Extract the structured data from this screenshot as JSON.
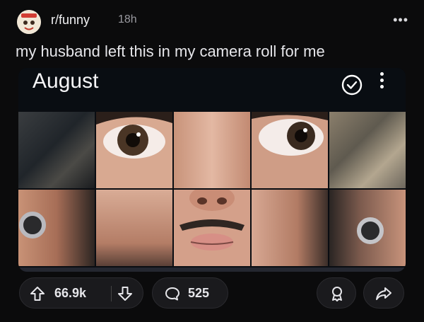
{
  "post": {
    "subreddit": "r/funny",
    "time": "18h",
    "more": "•••",
    "title": "my husband left this in my camera roll for me"
  },
  "media": {
    "album_title": "August"
  },
  "actions": {
    "upvotes": "66.9k",
    "comments": "525"
  },
  "icons": {
    "avatar": "subreddit-avatar",
    "more": "more-options-icon",
    "check": "select-check-icon",
    "kebab": "kebab-menu-icon",
    "upvote": "upvote-arrow-icon",
    "downvote": "downvote-arrow-icon",
    "comment": "comment-bubble-icon",
    "award": "award-icon",
    "share": "share-arrow-icon"
  },
  "colors": {
    "background": "#0b0b0c",
    "text": "#e8e8ea",
    "muted": "#9a9aa0",
    "pill": "#1a1a1d"
  }
}
